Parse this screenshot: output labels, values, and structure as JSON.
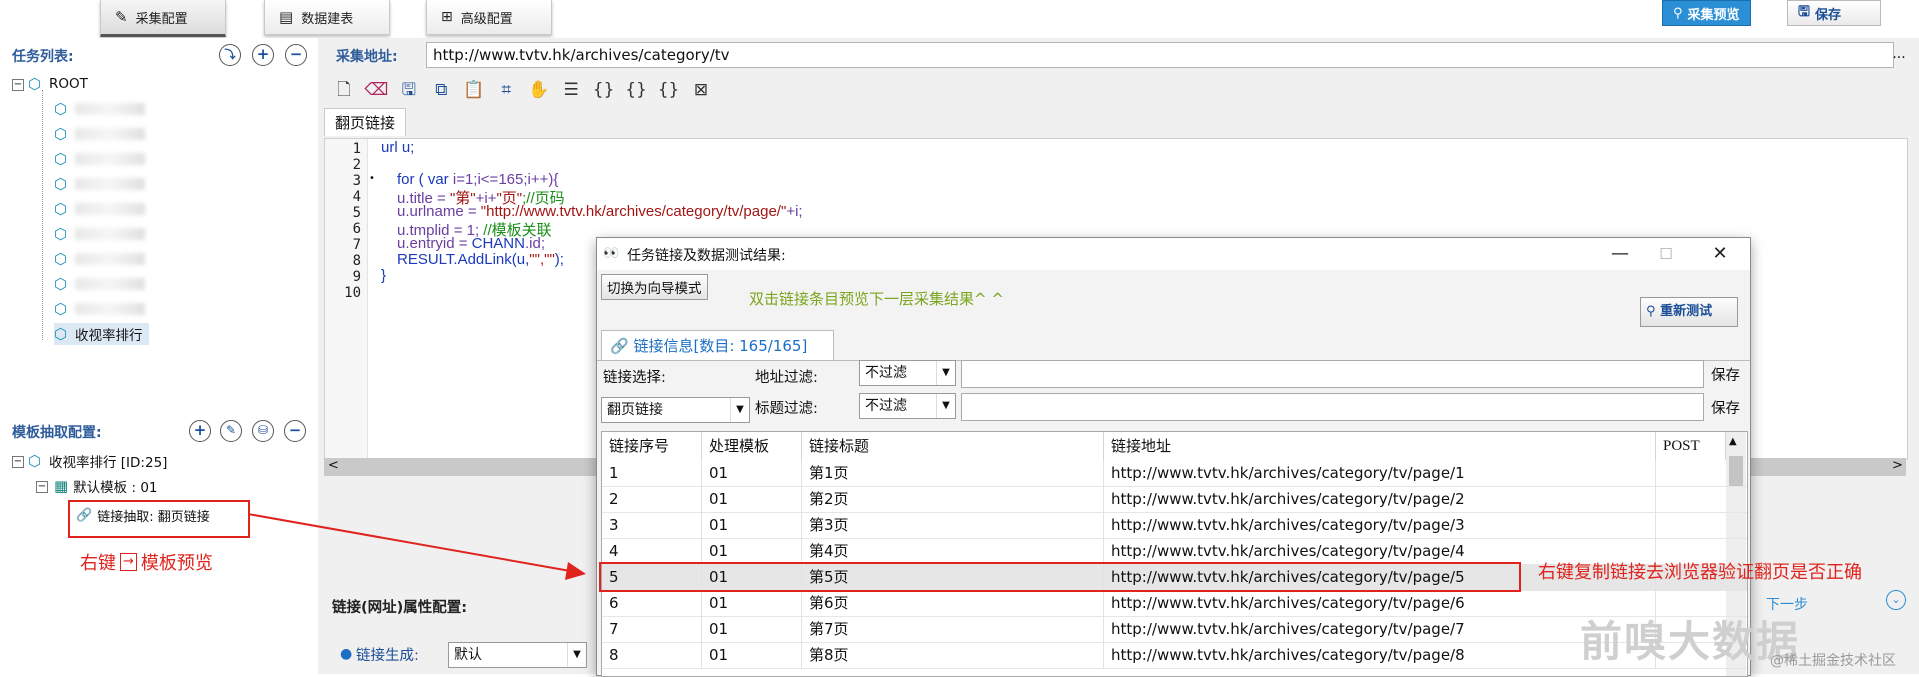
{
  "toolbar": {
    "tabs": [
      {
        "label": "采集配置",
        "icon": "edit-icon"
      },
      {
        "label": "数据建表",
        "icon": "document-icon"
      },
      {
        "label": "高级配置",
        "icon": "grid-icon"
      }
    ],
    "preview_label": "采集预览",
    "save_label": "保存"
  },
  "tasks": {
    "title": "任务列表:",
    "root_label": "ROOT",
    "last_item": "收视率排行"
  },
  "templates": {
    "title": "模板抽取配置:",
    "node_label": "收视率排行 [ID:25]",
    "default_template": "默认模板 : 01",
    "link_extract": "链接抽取: 翻页链接",
    "annotation": "右键",
    "annotation_arrow": "→",
    "annotation_rest": "模板预览"
  },
  "main": {
    "url_label": "采集地址:",
    "url_value": "http://www.tvtv.hk/archives/category/tv",
    "url_more": "...",
    "editor_tab": "翻页链接",
    "scroll_left": "<",
    "attr_title": "链接(网址)属性配置:",
    "link_gen_label": "链接生成:",
    "link_gen_value": "默认",
    "next_label": "下一步",
    "scroll_right": ">",
    "code": {
      "l1": "url u;",
      "l3a": "for ( ",
      "l3b": "var ",
      "l3c": "i=1;i<=165;i++){",
      "l4a": "u.title = ",
      "l4b": "\"第\"",
      "l4c": "+i+",
      "l4d": "\"页\"",
      "l4e": ";//页码",
      "l5a": "u.urlname = ",
      "l5b": "\"http://www.tvtv.hk/archives/category/tv/page/\"",
      "l5c": "+i;",
      "l6a": "u.tmplid = 1; ",
      "l6b": "//模板关联",
      "l7a": "u.entryid = ",
      "l7b": "CHANN",
      "l7c": ".id;",
      "l8a": "RESULT.AddLink(u,",
      "l8b": "\"\",\"\"",
      "l8c": ");",
      "l9": "}"
    }
  },
  "dialog": {
    "title": "任务链接及数据测试结果:",
    "wizard_btn": "切换为向导模式",
    "hint": "双击链接条目预览下一层采集结果^ ^",
    "retest_btn": "重新测试",
    "tab_label": "链接信息[数目: 165/165]",
    "link_select_label": "链接选择:",
    "link_select_value": "翻页链接",
    "addr_filter_label": "地址过滤:",
    "title_filter_label": "标题过滤:",
    "filter_value": "不过滤",
    "save": "保存",
    "columns": [
      "链接序号",
      "处理模板",
      "链接标题",
      "链接地址",
      "POST"
    ],
    "rows": [
      [
        "1",
        "01",
        "第1页",
        "http://www.tvtv.hk/archives/category/tv/page/1"
      ],
      [
        "2",
        "01",
        "第2页",
        "http://www.tvtv.hk/archives/category/tv/page/2"
      ],
      [
        "3",
        "01",
        "第3页",
        "http://www.tvtv.hk/archives/category/tv/page/3"
      ],
      [
        "4",
        "01",
        "第4页",
        "http://www.tvtv.hk/archives/category/tv/page/4"
      ],
      [
        "5",
        "01",
        "第5页",
        "http://www.tvtv.hk/archives/category/tv/page/5"
      ],
      [
        "6",
        "01",
        "第6页",
        "http://www.tvtv.hk/archives/category/tv/page/6"
      ],
      [
        "7",
        "01",
        "第7页",
        "http://www.tvtv.hk/archives/category/tv/page/7"
      ],
      [
        "8",
        "01",
        "第8页",
        "http://www.tvtv.hk/archives/category/tv/page/8"
      ]
    ]
  },
  "annotation_right": "右键复制链接去浏览器验证翻页是否正确",
  "watermark1": "前嗅大数据",
  "watermark2": "@稀土掘金技术社区",
  "colors": {
    "title_blue": "#2f5d9b",
    "highlight_red": "#e0231d",
    "hint_green": "#7aa51e"
  }
}
